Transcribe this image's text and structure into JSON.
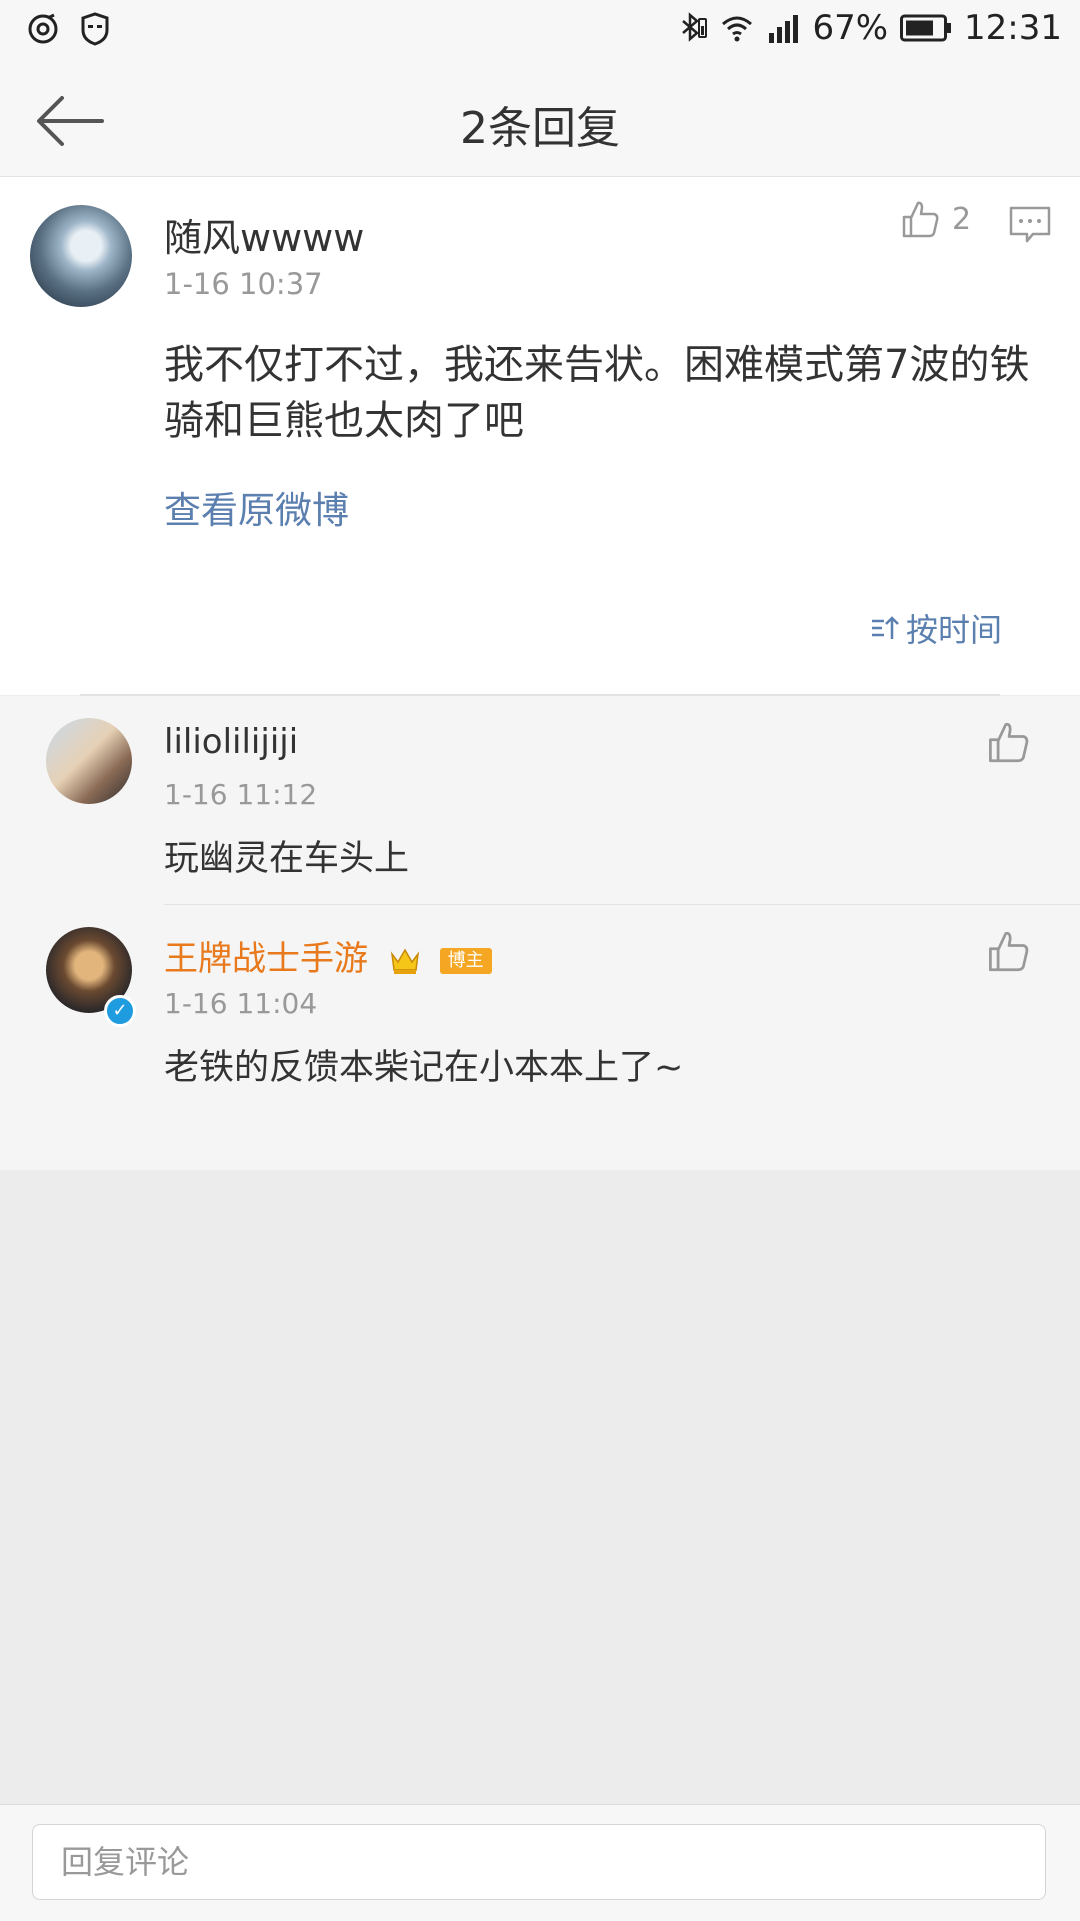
{
  "status_bar": {
    "left_icons": [
      "weibo-icon",
      "shield-face-icon"
    ],
    "right_icons": [
      "bluetooth-icon",
      "wifi-icon",
      "signal-icon",
      "battery-icon"
    ],
    "battery_percent": "67%",
    "time": "12:31"
  },
  "header": {
    "title": "2条回复",
    "back_icon": "back-arrow-icon"
  },
  "main_comment": {
    "username": "随风wwww",
    "time": "1-16 10:37",
    "like_count": "2",
    "text": "我不仅打不过，我还来告状。困难模式第7波的铁骑和巨熊也太肉了吧",
    "view_original": "查看原微博",
    "sort_label": "按时间"
  },
  "replies": [
    {
      "username": "liliolilijiji",
      "time": "1-16 11:12",
      "text": "玩幽灵在车头上"
    },
    {
      "username": "王牌战士手游",
      "badge": "博主",
      "time": "1-16 11:04",
      "text": "老铁的反馈本柴记在小本本上了~"
    }
  ],
  "bottom_bar": {
    "placeholder": "回复评论"
  },
  "colors": {
    "link_blue": "#5b7faf",
    "vip_orange": "#e8791c",
    "verified_blue": "#1f9be0"
  }
}
